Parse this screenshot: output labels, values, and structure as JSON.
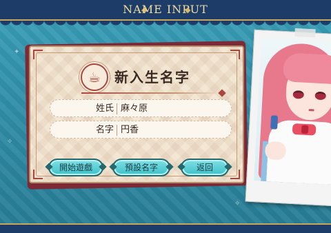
{
  "header": {
    "title": "NAME INPUT"
  },
  "card": {
    "title": "新入生名字",
    "fields": [
      {
        "label": "姓氏",
        "value": "麻々原"
      },
      {
        "label": "名字",
        "value": "円香"
      }
    ]
  },
  "buttons": {
    "start": "開始遊戲",
    "default_name": "預設名字",
    "back": "返回"
  },
  "colors": {
    "background": "#2f8fa6",
    "banner": "#1d3d68",
    "card": "#f3e6d3",
    "accent": "#a9463f",
    "button": "#3ec1c9"
  },
  "icons": {
    "emblem": "teacup-emblem-icon"
  }
}
